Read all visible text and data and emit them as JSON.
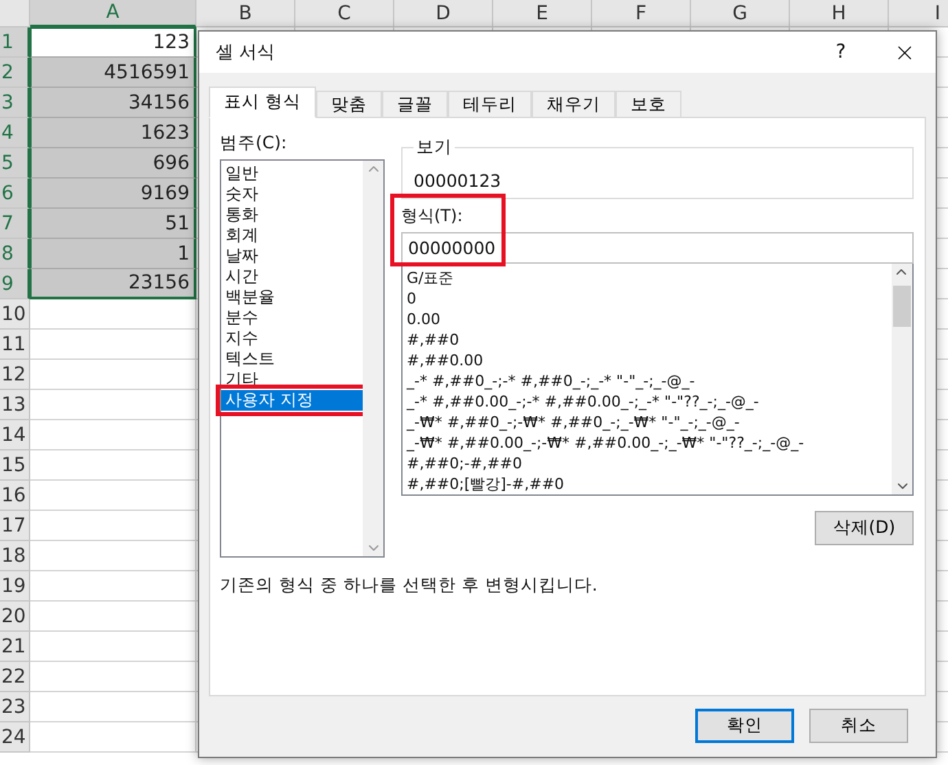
{
  "sheet": {
    "columns": [
      {
        "label": "A",
        "selected": true
      },
      {
        "label": "B",
        "selected": false
      },
      {
        "label": "C",
        "selected": false
      },
      {
        "label": "D",
        "selected": false
      },
      {
        "label": "E",
        "selected": false
      },
      {
        "label": "F",
        "selected": false
      },
      {
        "label": "G",
        "selected": false
      },
      {
        "label": "H",
        "selected": false
      },
      {
        "label": "I",
        "selected": false
      }
    ],
    "rows": [
      {
        "label": "1",
        "selected": true,
        "active": true,
        "value": "123"
      },
      {
        "label": "2",
        "selected": true,
        "active": false,
        "value": "4516591"
      },
      {
        "label": "3",
        "selected": true,
        "active": false,
        "value": "34156"
      },
      {
        "label": "4",
        "selected": true,
        "active": false,
        "value": "1623"
      },
      {
        "label": "5",
        "selected": true,
        "active": false,
        "value": "696"
      },
      {
        "label": "6",
        "selected": true,
        "active": false,
        "value": "9169"
      },
      {
        "label": "7",
        "selected": true,
        "active": false,
        "value": "51"
      },
      {
        "label": "8",
        "selected": true,
        "active": false,
        "value": "1"
      },
      {
        "label": "9",
        "selected": true,
        "active": false,
        "value": "23156"
      },
      {
        "label": "10",
        "selected": false,
        "active": false
      },
      {
        "label": "11",
        "selected": false,
        "active": false
      },
      {
        "label": "12",
        "selected": false,
        "active": false
      },
      {
        "label": "13",
        "selected": false,
        "active": false
      },
      {
        "label": "14",
        "selected": false,
        "active": false
      },
      {
        "label": "15",
        "selected": false,
        "active": false
      },
      {
        "label": "16",
        "selected": false,
        "active": false
      },
      {
        "label": "17",
        "selected": false,
        "active": false
      },
      {
        "label": "18",
        "selected": false,
        "active": false
      },
      {
        "label": "19",
        "selected": false,
        "active": false
      },
      {
        "label": "20",
        "selected": false,
        "active": false
      },
      {
        "label": "21",
        "selected": false,
        "active": false
      },
      {
        "label": "22",
        "selected": false,
        "active": false
      },
      {
        "label": "23",
        "selected": false,
        "active": false
      },
      {
        "label": "24",
        "selected": false,
        "active": false
      }
    ]
  },
  "dialog": {
    "title": "셀 서식",
    "help": "?",
    "tabs": [
      {
        "label": "표시 형식",
        "selected": true
      },
      {
        "label": "맞춤",
        "selected": false
      },
      {
        "label": "글꼴",
        "selected": false
      },
      {
        "label": "테두리",
        "selected": false
      },
      {
        "label": "채우기",
        "selected": false
      },
      {
        "label": "보호",
        "selected": false
      }
    ],
    "category_label": "범주(C):",
    "categories": [
      {
        "label": "일반",
        "selected": false,
        "highlighted": false
      },
      {
        "label": "숫자",
        "selected": false,
        "highlighted": false
      },
      {
        "label": "통화",
        "selected": false,
        "highlighted": false
      },
      {
        "label": "회계",
        "selected": false,
        "highlighted": false
      },
      {
        "label": "날짜",
        "selected": false,
        "highlighted": false
      },
      {
        "label": "시간",
        "selected": false,
        "highlighted": false
      },
      {
        "label": "백분율",
        "selected": false,
        "highlighted": false
      },
      {
        "label": "분수",
        "selected": false,
        "highlighted": false
      },
      {
        "label": "지수",
        "selected": false,
        "highlighted": false
      },
      {
        "label": "텍스트",
        "selected": false,
        "highlighted": false
      },
      {
        "label": "기타",
        "selected": false,
        "highlighted": false
      },
      {
        "label": "사용자 지정",
        "selected": true,
        "highlighted": true
      }
    ],
    "preview": {
      "label": "보기",
      "value": "00000123"
    },
    "format": {
      "label": "형식(T):",
      "value": "00000000",
      "highlighted": true
    },
    "formats": [
      "G/표준",
      "0",
      "0.00",
      "#,##0",
      "#,##0.00",
      "_-* #,##0_-;-* #,##0_-;_-* \"-\"_-;_-@_-",
      "_-* #,##0.00_-;-* #,##0.00_-;_-* \"-\"??_-;_-@_-",
      "_-₩* #,##0_-;-₩* #,##0_-;_-₩* \"-\"_-;_-@_-",
      "_-₩* #,##0.00_-;-₩* #,##0.00_-;_-₩* \"-\"??_-;_-@_-",
      "#,##0;-#,##0",
      "#,##0;[빨강]-#,##0"
    ],
    "delete_button": "삭제(D)",
    "description": "기존의 형식 중 하나를 선택한 후 변형시킵니다.",
    "buttons": [
      {
        "label": "확인",
        "default": true
      },
      {
        "label": "취소",
        "default": false
      }
    ]
  }
}
